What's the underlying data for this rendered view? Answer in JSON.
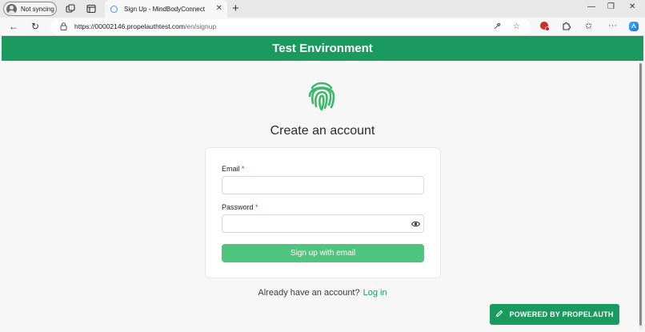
{
  "browser": {
    "profile_label": "Not syncing",
    "tab_title": "Sign Up - MindBodyConnect",
    "url_host": "https://00002146.propelauthtest.com",
    "url_path": "/en/signup",
    "accent": "#5d8fd8"
  },
  "page": {
    "banner": "Test Environment",
    "heading": "Create an account",
    "email_label": "Email",
    "password_label": "Password",
    "required_mark": "*",
    "email_value": "",
    "password_value": "",
    "submit_label": "Sign up with email",
    "login_prompt": "Already have an account?",
    "login_link": "Log in",
    "powered_by": "POWERED BY PROPELAUTH",
    "colors": {
      "brand_green": "#1b9a5f",
      "button_green": "#4fc47d",
      "logo_green": "#3cb86a"
    }
  }
}
